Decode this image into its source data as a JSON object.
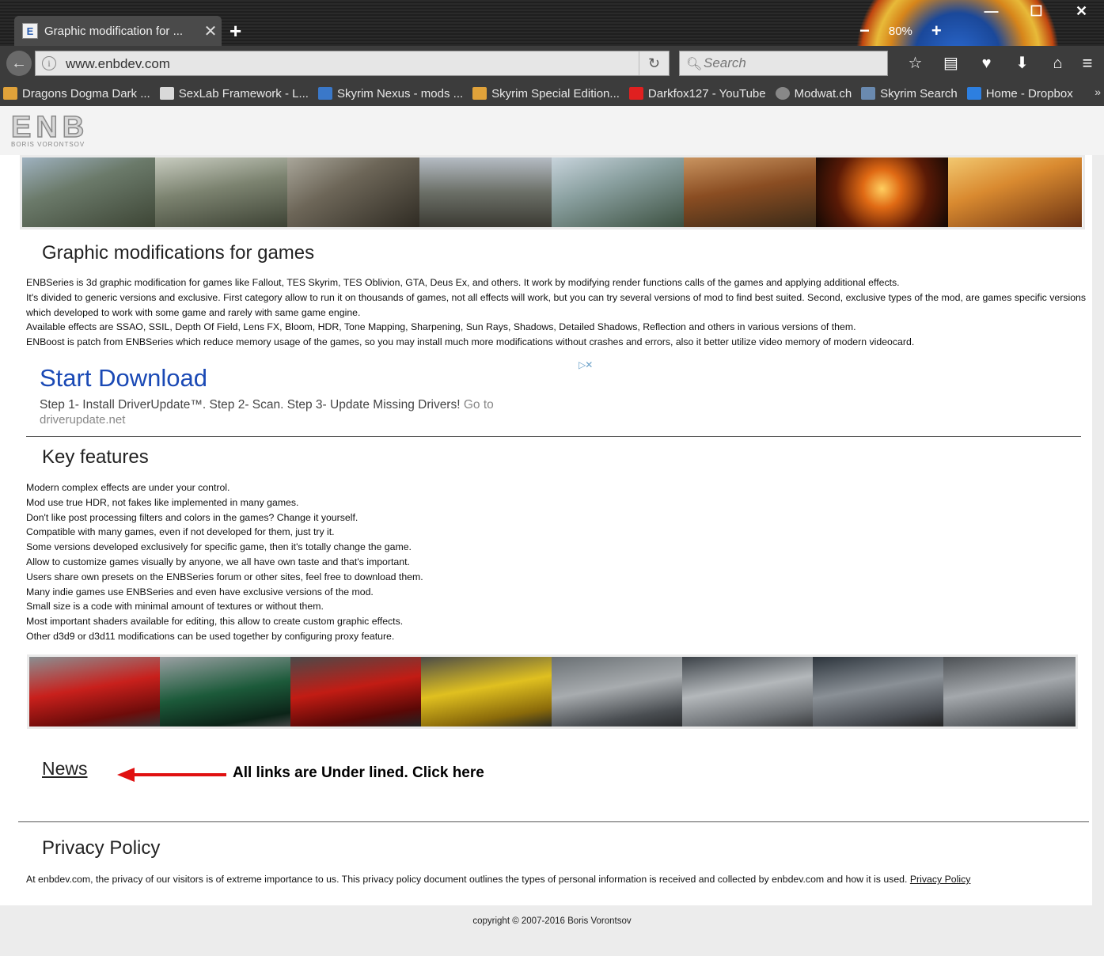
{
  "browser": {
    "tab": {
      "title": "Graphic modification for ...",
      "favicon": "E"
    },
    "zoom": "80%",
    "url": "www.enbdev.com",
    "search_placeholder": "Search",
    "bookmarks": [
      {
        "label": "Dragons Dogma Dark ...",
        "color": "#e0a23a"
      },
      {
        "label": "SexLab Framework - L...",
        "color": "#d9d9d9"
      },
      {
        "label": "Skyrim Nexus - mods ...",
        "color": "#3a78c9"
      },
      {
        "label": "Skyrim Special Edition...",
        "color": "#e0a23a"
      },
      {
        "label": "Darkfox127 - YouTube",
        "color": "#e02020"
      },
      {
        "label": "Modwat.ch",
        "color": "#888888"
      },
      {
        "label": "Skyrim Search",
        "color": "#6a8ab0"
      },
      {
        "label": "Home - Dropbox",
        "color": "#2d7fe0"
      }
    ]
  },
  "site": {
    "logo_main": "ENB",
    "logo_sub": "BORIS VORONTSOV",
    "intro": {
      "title": "Graphic modifications for games",
      "paragraphs": [
        "ENBSeries is 3d graphic modification for games like Fallout, TES Skyrim, TES Oblivion, GTA, Deus Ex, and others. It work by modifying render functions calls of the games and applying additional effects.",
        "It's divided to generic versions and exclusive. First category allow to run it on thousands of games, not all effects will work, but you can try several versions of mod to find best suited. Second, exclusive types of the mod, are games specific versions which developed to work with some game and rarely with same game engine.",
        "Available effects are SSAO, SSIL, Depth Of Field, Lens FX, Bloom, HDR, Tone Mapping, Sharpening, Sun Rays, Shadows, Detailed Shadows, Reflection and others in various versions of them.",
        "ENBoost is patch from ENBSeries which reduce memory usage of the games, so you may install much more modifications without crashes and errors, also it better utilize video memory of modern videocard."
      ]
    },
    "ad": {
      "title": "Start Download",
      "description": "Step 1- Install DriverUpdate™. Step 2- Scan. Step 3- Update Missing Drivers!",
      "goto": "Go to",
      "url": "driverupdate.net"
    },
    "features": {
      "title": "Key features",
      "items": [
        "Modern complex effects are under your control.",
        "Mod use true HDR, not fakes like implemented in many games.",
        "Don't like post processing filters and colors in the games? Change it yourself.",
        "Compatible with many games, even if not developed for them, just try it.",
        "Some versions developed exclusively for specific game, then it's totally change the game.",
        "Allow to customize games visually by anyone, we all have own taste and that's important.",
        "Users share own presets on the ENBSeries forum or other sites, feel free to download them.",
        "Many indie games use ENBSeries and even have exclusive versions of the mod.",
        "Small size is a code with minimal amount of textures or without them.",
        "Most important shaders available for editing, this allow to create custom graphic effects.",
        "Other d3d9 or d3d11 modifications can be used together by configuring proxy feature."
      ]
    },
    "news_link": "News",
    "annotation": "All links are Under lined. Click here",
    "privacy": {
      "title": "Privacy Policy",
      "text": "At enbdev.com, the privacy of our visitors is of extreme importance to us. This privacy policy document outlines the types of personal information is received and collected by enbdev.com and how it is used.",
      "link": "Privacy Policy"
    },
    "copyright": "copyright © 2007-2016 Boris Vorontsov"
  }
}
